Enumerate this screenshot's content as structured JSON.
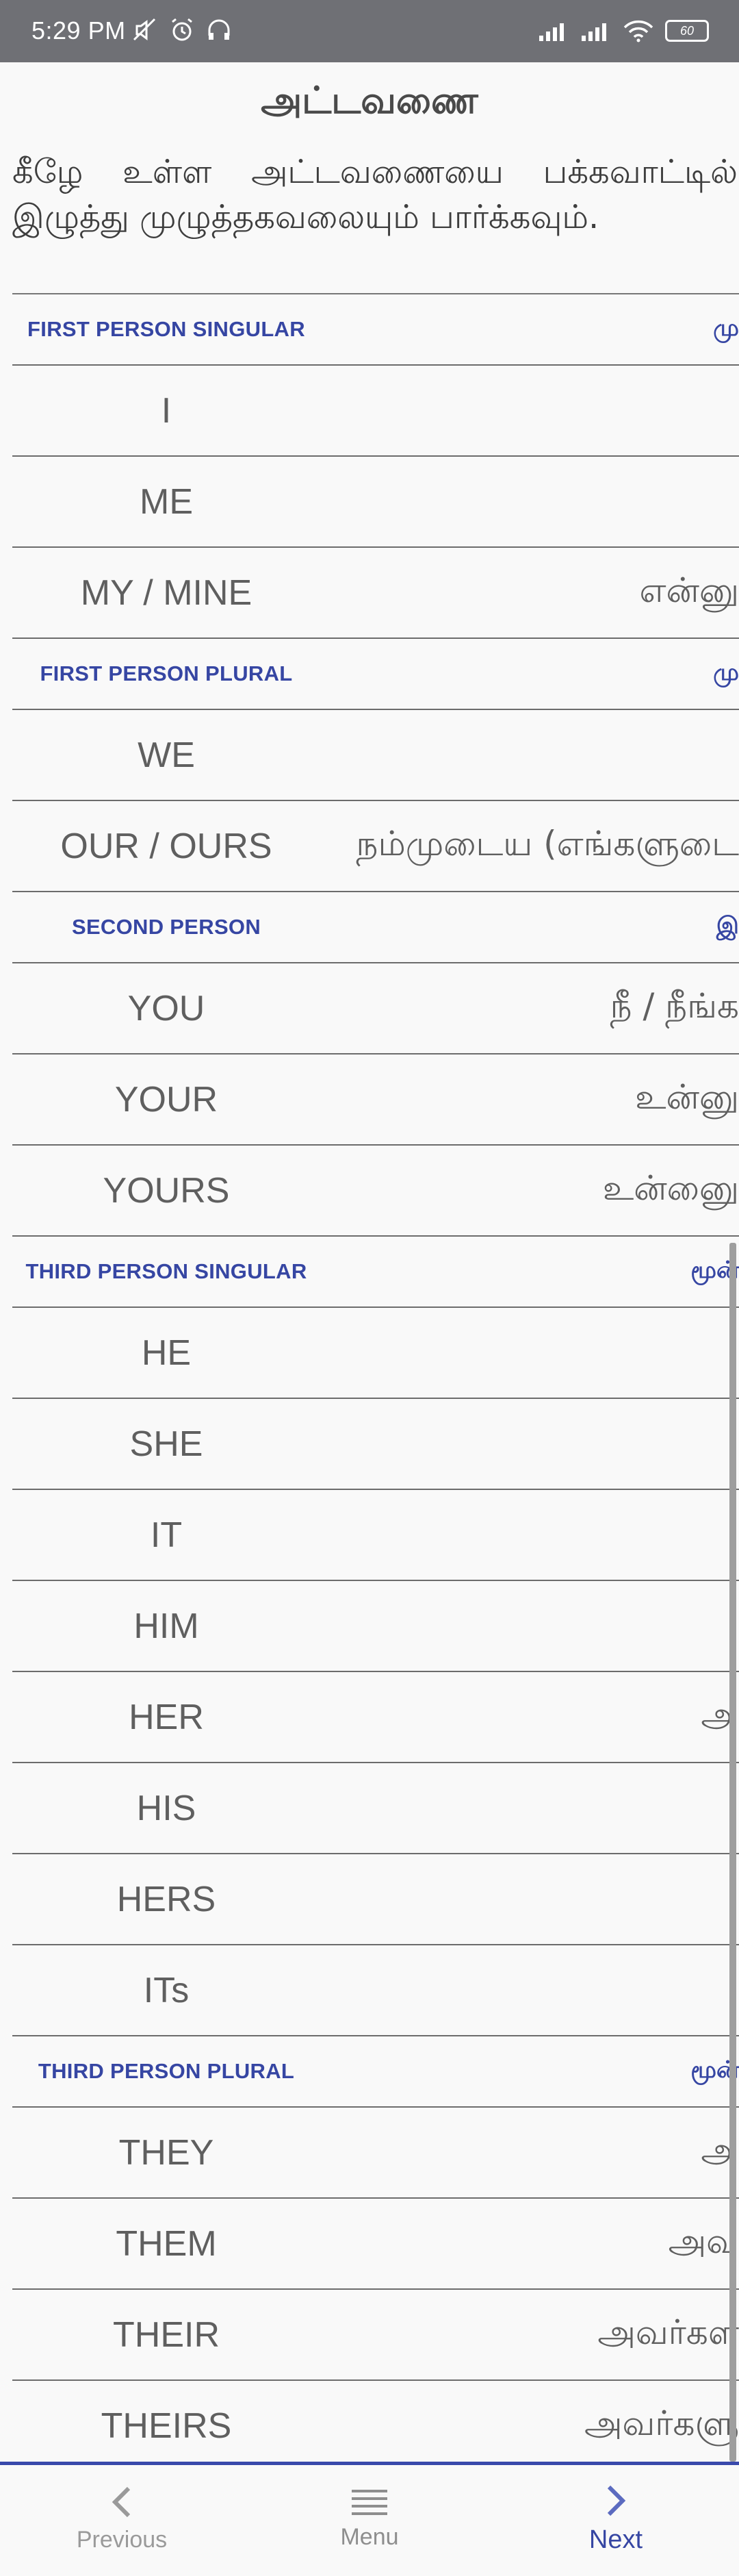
{
  "status_bar": {
    "time": "5:29 PM",
    "battery": "60",
    "left_icons": [
      "mute-icon",
      "alarm-icon",
      "headset-icon"
    ],
    "right_icons": [
      "signal-icon",
      "signal-icon",
      "wifi-icon",
      "battery-icon"
    ]
  },
  "page": {
    "title": "அட்டவணை",
    "intro": "கீழே உள்ள அட்டவணையை பக்கவாட்டில் இழுத்து முழுத்தகவலையும் பார்க்கவும்."
  },
  "sections": [
    {
      "heading_en": "FIRST PERSON SINGULAR",
      "heading_ta": "மு",
      "rows": [
        {
          "en": "I",
          "ta": ""
        },
        {
          "en": "ME",
          "ta": ""
        },
        {
          "en": "MY / MINE",
          "ta": "என்னு"
        }
      ]
    },
    {
      "heading_en": "FIRST PERSON PLURAL",
      "heading_ta": "மு",
      "rows": [
        {
          "en": "WE",
          "ta": ""
        },
        {
          "en": "OUR / OURS",
          "ta": "நம்முடைய (எங்களுடை"
        }
      ]
    },
    {
      "heading_en": "SECOND PERSON",
      "heading_ta": "இ",
      "rows": [
        {
          "en": "YOU",
          "ta": "நீ / நீங்க"
        },
        {
          "en": "YOUR",
          "ta": "உன்னு"
        },
        {
          "en": "YOURS",
          "ta": "உன்னுை"
        }
      ]
    },
    {
      "heading_en": "THIRD PERSON SINGULAR",
      "heading_ta": "மூன்",
      "rows": [
        {
          "en": "HE",
          "ta": ""
        },
        {
          "en": "SHE",
          "ta": ""
        },
        {
          "en": "IT",
          "ta": ""
        },
        {
          "en": "HIM",
          "ta": ""
        },
        {
          "en": "HER",
          "ta": "அ"
        },
        {
          "en": "HIS",
          "ta": ""
        },
        {
          "en": "HERS",
          "ta": ""
        },
        {
          "en": "ITs",
          "ta": ""
        }
      ]
    },
    {
      "heading_en": "THIRD PERSON PLURAL",
      "heading_ta": "மூன்",
      "rows": [
        {
          "en": "THEY",
          "ta": "அ"
        },
        {
          "en": "THEM",
          "ta": "அவ"
        },
        {
          "en": "THEIR",
          "ta": "அவர்கள"
        },
        {
          "en": "THEIRS",
          "ta": "அவர்களு"
        }
      ]
    }
  ],
  "bottom_nav": {
    "previous": "Previous",
    "menu": "Menu",
    "next": "Next"
  },
  "colors": {
    "status_bar": "#6f7075",
    "accent": "#3646a3",
    "background": "#f9f9f9"
  }
}
